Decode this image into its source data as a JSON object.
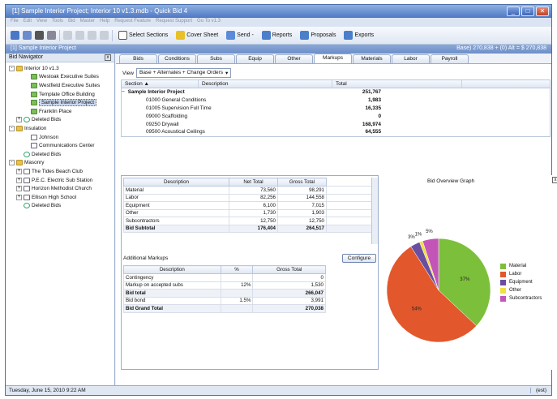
{
  "window": {
    "title": "[1] Sample Interior Project; Interior 10 v1.3.mdb - Quick Bid 4",
    "controls": [
      "_",
      "□",
      "✕"
    ]
  },
  "menu": [
    "File",
    "Edit",
    "View",
    "Tools",
    "Bid",
    "Master",
    "Help",
    "Request Feature",
    "Request Support",
    "Go To v1.3"
  ],
  "toolbar": {
    "select_sections": "Select Sections",
    "cover_sheet": "Cover Sheet",
    "send": "Send -",
    "reports": "Reports",
    "proposals": "Proposals",
    "exports": "Exports"
  },
  "project_bar": {
    "name": "[1] Sample Interior Project",
    "base": "Base) 270,838 + (0) Alt = $ 270,838"
  },
  "navigator": {
    "title": "Bid Navigator",
    "nodes": [
      {
        "label": "Interior 10 v1.3",
        "level": 0,
        "icon": "folder",
        "exp": "-"
      },
      {
        "label": "Westoak Executive Suites",
        "level": 2,
        "icon": "green"
      },
      {
        "label": "Westfield Executive Suites",
        "level": 2,
        "icon": "green"
      },
      {
        "label": "Template Office Building",
        "level": 2,
        "icon": "green"
      },
      {
        "label": "Sample Interior Project",
        "level": 2,
        "icon": "green",
        "selected": true
      },
      {
        "label": "Franklin Place",
        "level": 2,
        "icon": "green"
      },
      {
        "label": "Deleted Bids",
        "level": 1,
        "icon": "del",
        "exp": "+"
      },
      {
        "label": "Insulation",
        "level": 0,
        "icon": "folder",
        "exp": "-"
      },
      {
        "label": "Johnson",
        "level": 2,
        "icon": "doc"
      },
      {
        "label": "Communications Center",
        "level": 2,
        "icon": "doc"
      },
      {
        "label": "Deleted Bids",
        "level": 1,
        "icon": "del"
      },
      {
        "label": "Masonry",
        "level": 0,
        "icon": "folder",
        "exp": "-"
      },
      {
        "label": "The Tides Beach Club",
        "level": 1,
        "icon": "doc",
        "exp": "+"
      },
      {
        "label": "P.E.C. Electric Sub Station",
        "level": 1,
        "icon": "doc",
        "exp": "+"
      },
      {
        "label": "Horizon Methodist Church",
        "level": 1,
        "icon": "doc",
        "exp": "+"
      },
      {
        "label": "Ellison High School",
        "level": 1,
        "icon": "doc",
        "exp": "+"
      },
      {
        "label": "Deleted Bids",
        "level": 1,
        "icon": "del"
      }
    ]
  },
  "tabs": [
    "Bids",
    "Conditions",
    "Subs",
    "Equip",
    "Other",
    "Markups",
    "Materials",
    "Labor",
    "Payroll"
  ],
  "active_tab": "Markups",
  "view": {
    "label": "View",
    "value": "Base + Alternates + Change Orders"
  },
  "sections": {
    "headers": [
      "Section",
      "Description",
      "Total"
    ],
    "rows": [
      {
        "name": "Sample Interior Project",
        "total": "251,767",
        "top": true
      },
      {
        "name": "01000 General Conditions",
        "total": "1,983"
      },
      {
        "name": "01005 Supervision Full Time",
        "total": "16,335"
      },
      {
        "name": "09000 Scaffolding",
        "total": "0"
      },
      {
        "name": "09250 Drywall",
        "total": "168,974"
      },
      {
        "name": "09500 Acoustical Ceilings",
        "total": "64,555"
      }
    ]
  },
  "cost_table": {
    "headers": [
      "Description",
      "Net Total",
      "Gross Total"
    ],
    "rows": [
      [
        "Material",
        "73,560",
        "98,291"
      ],
      [
        "Labor",
        "82,256",
        "144,558"
      ],
      [
        "Equipment",
        "6,100",
        "7,015"
      ],
      [
        "Other",
        "1,730",
        "1,903"
      ],
      [
        "Subcontractors",
        "12,750",
        "12,750"
      ]
    ],
    "subtotal": [
      "Bid Subtotal",
      "176,404",
      "264,517"
    ]
  },
  "additional_markups": {
    "label": "Additional Markups",
    "configure": "Configure",
    "headers": [
      "Description",
      "%",
      "Gross Total"
    ],
    "rows": [
      [
        "Contingency",
        "",
        "0",
        false
      ],
      [
        "Markup on accepted subs",
        "12%",
        "1,530",
        false
      ],
      [
        "Bid total",
        "",
        "266,047",
        true
      ],
      [
        "Bid bond",
        "1.5%",
        "3,991",
        false
      ],
      [
        "Bid Grand Total",
        "",
        "270,038",
        true
      ]
    ]
  },
  "graph": {
    "title": "Bid Overview Graph"
  },
  "chart_data": {
    "type": "pie",
    "title": "Bid Overview Graph",
    "categories": [
      "Material",
      "Labor",
      "Equipment",
      "Other",
      "Subcontractors"
    ],
    "values": [
      37,
      54,
      3,
      1,
      5
    ],
    "labels": [
      "37%",
      "54%",
      "3%",
      "1%",
      "5%"
    ],
    "colors": [
      "#7cbf3a",
      "#e2572b",
      "#6a4fa0",
      "#f0e040",
      "#c455b8"
    ],
    "legend": "right"
  },
  "status": {
    "left": "Tuesday, June 15, 2010 9:22 AM",
    "right": "(est)"
  }
}
